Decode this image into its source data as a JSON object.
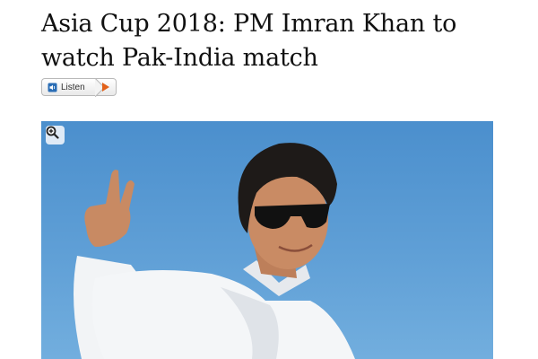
{
  "article": {
    "headline": "Asia Cup 2018: PM Imran Khan to watch Pak-India match"
  },
  "listen": {
    "label": "Listen"
  },
  "colors": {
    "sky": "#5a9bd5",
    "play_accent": "#e2621b",
    "speaker_blue": "#2a6db5"
  },
  "icons": {
    "speaker": "speaker-icon",
    "play": "play-icon",
    "zoom": "zoom-in-icon"
  }
}
